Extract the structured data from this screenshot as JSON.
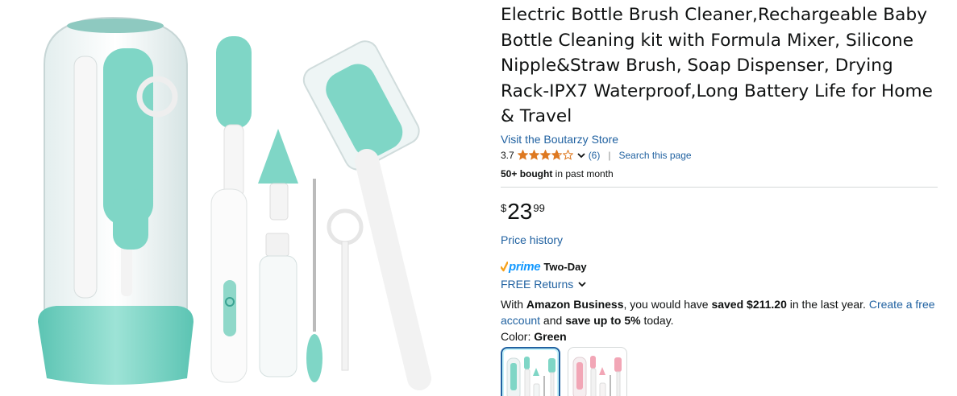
{
  "product": {
    "title": "Electric Bottle Brush Cleaner,Rechargeable Baby Bottle Cleaning kit with Formula Mixer, Silicone Nipple&Straw Brush, Soap Dispenser, Drying Rack-IPX7 Waterproof,Long Battery Life for Home & Travel",
    "store_link": "Visit the Boutarzy Store",
    "rating": "3.7",
    "rating_value": 3.7,
    "rating_count": "(6)",
    "separator": "|",
    "search_link": "Search this page",
    "bought_bold": "50+ bought",
    "bought_rest": " in past month"
  },
  "price": {
    "symbol": "$",
    "whole": "23",
    "fraction": "99",
    "history_link": "Price history"
  },
  "delivery": {
    "prime_word": "prime",
    "prime_speed": "Two-Day",
    "returns": "FREE Returns"
  },
  "business": {
    "prefix": "With ",
    "name": "Amazon Business",
    "middle": ", you would have ",
    "saved": "saved $211.20",
    "after_saved": " in the last year. ",
    "create_link": "Create a free account",
    "and": " and ",
    "save_up": "save up to 5%",
    "end": " today."
  },
  "variant": {
    "label": "Color: ",
    "selected": "Green",
    "swatches": [
      "Green",
      "Pink"
    ]
  },
  "colors": {
    "link": "#2162a1",
    "prime_blue": "#1399ff",
    "star": "#de7921",
    "mint": "#7fd6c6",
    "swatch_selected_border": "#2162a1"
  },
  "icons": {
    "star": "star-icon",
    "chevron": "chevron-down-icon",
    "prime_check": "prime-check-icon"
  }
}
